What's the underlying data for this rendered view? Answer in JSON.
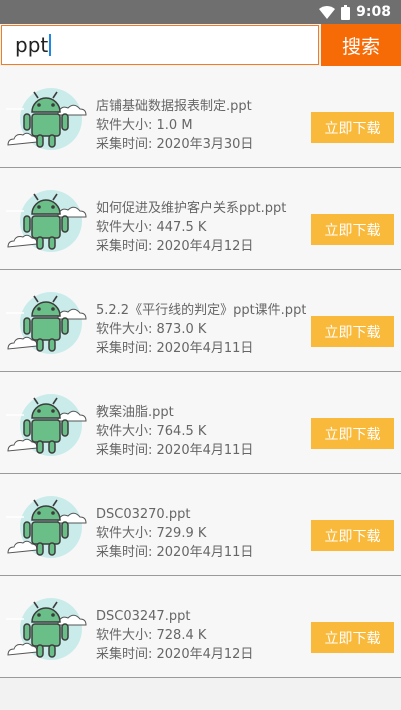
{
  "status_bar": {
    "time": "9:08"
  },
  "search": {
    "query": "ppt",
    "button_label": "搜索"
  },
  "items": [
    {
      "title": "店铺基础数据报表制定.ppt",
      "size": "软件大小: 1.0 M",
      "date": "采集时间: 2020年3月30日",
      "button": "立即下载"
    },
    {
      "title": "如何促进及维护客户关系ppt.ppt",
      "size": "软件大小: 447.5 K",
      "date": "采集时间: 2020年4月12日",
      "button": "立即下载"
    },
    {
      "title": "5.2.2《平行线的判定》ppt课件.ppt",
      "size": "软件大小: 873.0 K",
      "date": "采集时间: 2020年4月11日",
      "button": "立即下载"
    },
    {
      "title": "教案油脂.ppt",
      "size": "软件大小: 764.5 K",
      "date": "采集时间: 2020年4月11日",
      "button": "立即下载"
    },
    {
      "title": "DSC03270.ppt",
      "size": "软件大小: 729.9 K",
      "date": "采集时间: 2020年4月11日",
      "button": "立即下载"
    },
    {
      "title": "DSC03247.ppt",
      "size": "软件大小: 728.4 K",
      "date": "采集时间: 2020年4月12日",
      "button": "立即下载"
    }
  ]
}
